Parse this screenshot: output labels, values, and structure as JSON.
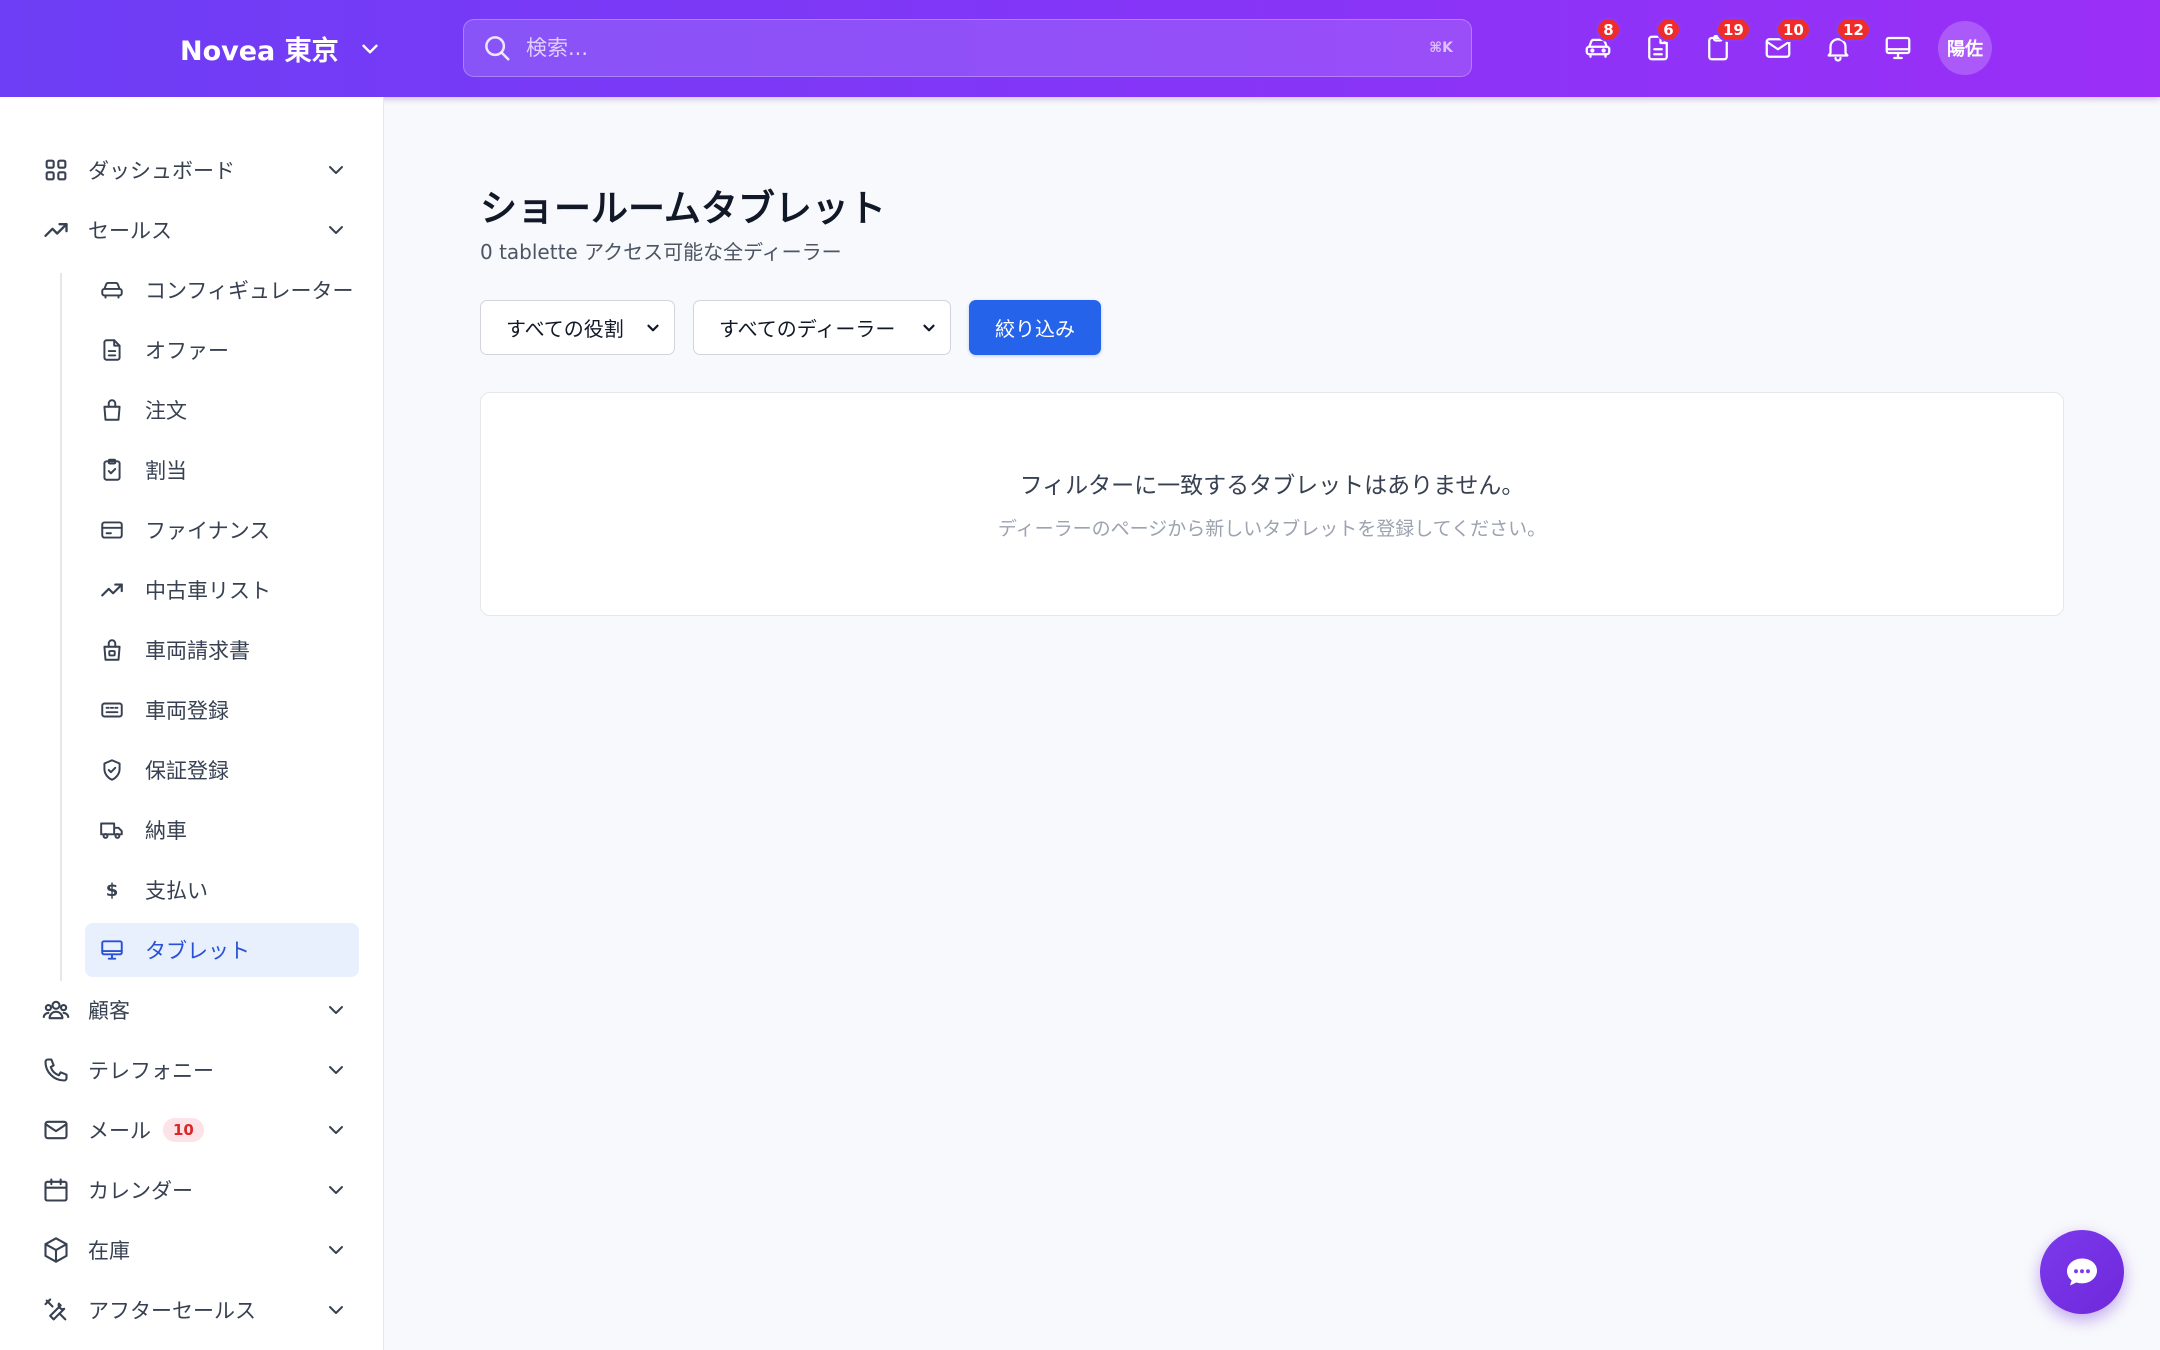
{
  "header": {
    "brand": "Novea 東京",
    "search_placeholder": "検索...",
    "search_shortcut": "⌘K",
    "icons": [
      {
        "name": "car-icon",
        "badge": "8"
      },
      {
        "name": "document-icon",
        "badge": "6"
      },
      {
        "name": "clipboard-icon",
        "badge": "19"
      },
      {
        "name": "mail-icon",
        "badge": "10"
      },
      {
        "name": "bell-icon",
        "badge": "12"
      },
      {
        "name": "monitor-icon",
        "badge": ""
      }
    ],
    "avatar": "陽佐"
  },
  "sidebar": {
    "top": [
      {
        "label": "ダッシュボード",
        "icon": "grid-icon"
      },
      {
        "label": "セールス",
        "icon": "trending-up-icon"
      }
    ],
    "sales_sub": [
      {
        "label": "コンフィギュレーター",
        "icon": "car-icon"
      },
      {
        "label": "オファー",
        "icon": "document-icon"
      },
      {
        "label": "注文",
        "icon": "shopping-bag-icon"
      },
      {
        "label": "割当",
        "icon": "clipboard-check-icon"
      },
      {
        "label": "ファイナンス",
        "icon": "credit-card-icon"
      },
      {
        "label": "中古車リスト",
        "icon": "trending-up-icon"
      },
      {
        "label": "車両請求書",
        "icon": "bag-lock-icon"
      },
      {
        "label": "車両登録",
        "icon": "id-card-icon"
      },
      {
        "label": "保証登録",
        "icon": "shield-check-icon"
      },
      {
        "label": "納車",
        "icon": "truck-icon"
      },
      {
        "label": "支払い",
        "icon": "dollar-icon",
        "glyph": "$"
      },
      {
        "label": "タブレット",
        "icon": "monitor-icon",
        "active": true
      }
    ],
    "bottom": [
      {
        "label": "顧客",
        "icon": "users-icon"
      },
      {
        "label": "テレフォニー",
        "icon": "phone-icon"
      },
      {
        "label": "メール",
        "icon": "mail-icon",
        "badge": "10"
      },
      {
        "label": "カレンダー",
        "icon": "calendar-icon"
      },
      {
        "label": "在庫",
        "icon": "box-icon"
      },
      {
        "label": "アフターセールス",
        "icon": "tools-icon"
      }
    ]
  },
  "main": {
    "title": "ショールームタブレット",
    "subtitle": "0 tablette アクセス可能な全ディーラー",
    "filters": {
      "role_select": "すべての役割",
      "dealer_select": "すべてのディーラー",
      "filter_button": "絞り込み"
    },
    "empty": {
      "title": "フィルターに一致するタブレットはありません。",
      "subtitle": "ディーラーのページから新しいタブレットを登録してください。"
    }
  },
  "colors": {
    "header_start": "#6d3ef5",
    "header_end": "#9b2ff7",
    "primary_button": "#2563eb",
    "active_nav_bg": "#e8effd",
    "active_nav_text": "#2950d8",
    "badge": "#ef2b2b"
  }
}
